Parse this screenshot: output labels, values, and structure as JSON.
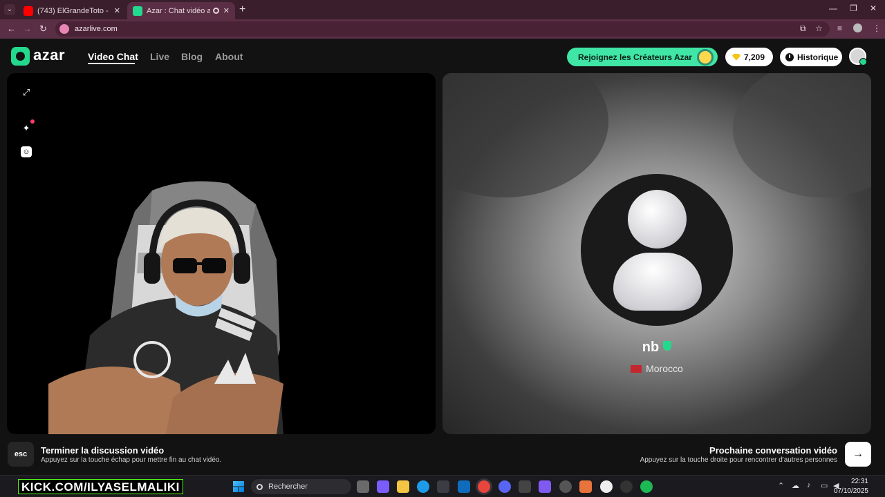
{
  "browser": {
    "tabs": [
      {
        "title": "(743) ElGrandeToto - WELD LA...",
        "active": false
      },
      {
        "title": "Azar : Chat vidéo avec de n...",
        "active": true
      }
    ],
    "url": "azarlive.com"
  },
  "app": {
    "logo_text": "azar",
    "nav": [
      {
        "label": "Video Chat",
        "active": true
      },
      {
        "label": "Live",
        "active": false
      },
      {
        "label": "Blog",
        "active": false
      },
      {
        "label": "About",
        "active": false
      }
    ],
    "creators_label": "Rejoignez les Créateurs Azar",
    "gems_count": "7,209",
    "history_label": "Historique",
    "accent_color": "#3fe6a5"
  },
  "peer": {
    "name": "nb",
    "country": "Morocco",
    "verified_icon": "shield-check-icon"
  },
  "controls": {
    "esc_key": "esc",
    "end_title": "Terminer la discussion vidéo",
    "end_subtitle": "Appuyez sur la touche échap pour mettre fin au chat vidéo.",
    "next_title": "Prochaine conversation vidéo",
    "next_subtitle": "Appuyez sur la touche droite pour rencontrer d'autres personnes",
    "next_arrow": "→"
  },
  "taskbar": {
    "banner": "KICK.COM/ILYASELMALIKI",
    "search_placeholder": "Rechercher",
    "time": "22:31",
    "date": "07/10/2025"
  }
}
